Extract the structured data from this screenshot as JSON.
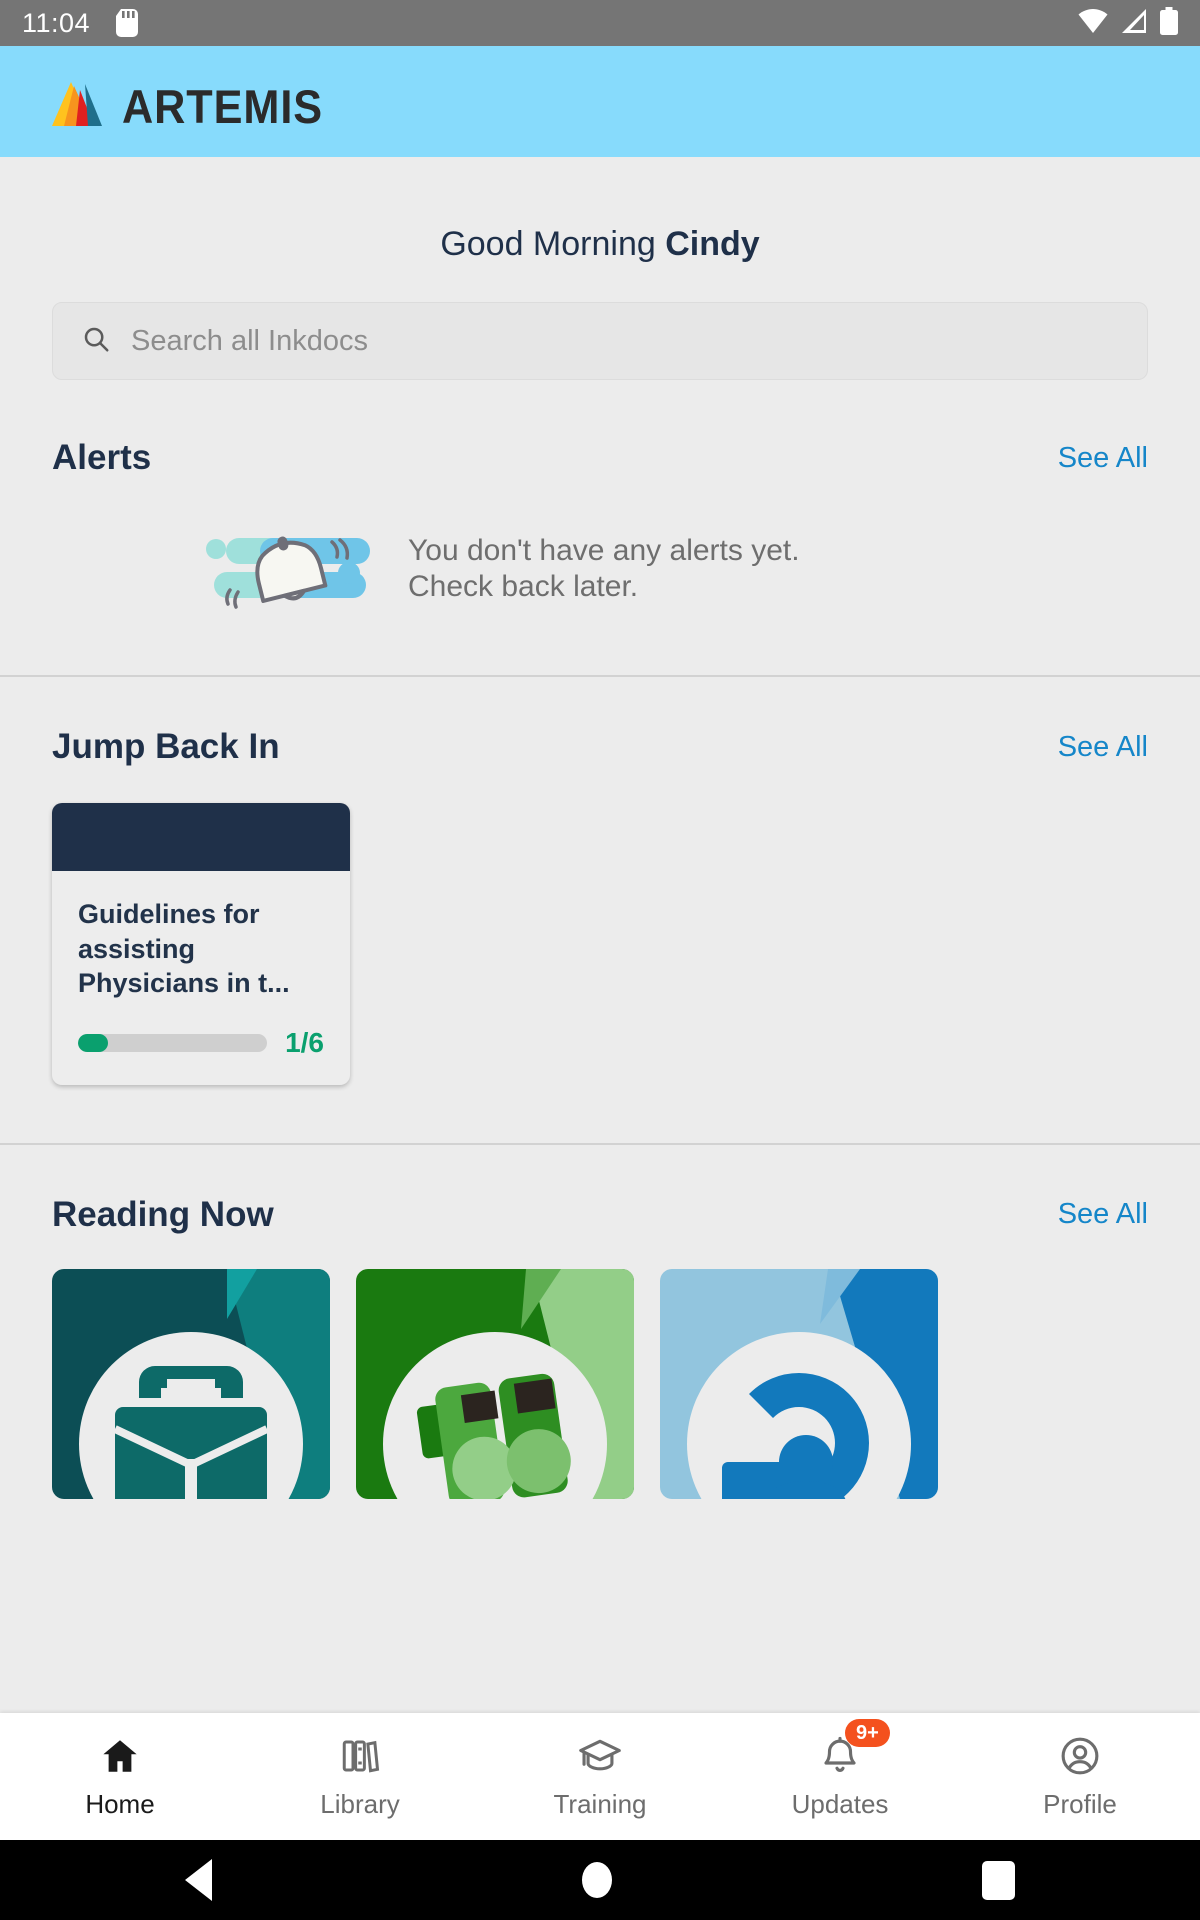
{
  "status_bar": {
    "time": "11:04",
    "sd_card_icon": "sd-card-icon",
    "wifi_icon": "wifi-icon",
    "signal_icon": "cellular-signal-icon",
    "battery_icon": "battery-icon"
  },
  "app_bar": {
    "brand": "ARTEMIS",
    "logo_icon": "artemis-mountain-logo",
    "background": "#87DBFC",
    "logo_colors": [
      "#FFC21E",
      "#F7941E",
      "#E02020",
      "#1F6F8B"
    ]
  },
  "greeting": {
    "prefix": "Good Morning ",
    "name": "Cindy"
  },
  "search": {
    "placeholder": "Search all Inkdocs",
    "value": "",
    "icon": "search-icon"
  },
  "alerts": {
    "title": "Alerts",
    "see_all": "See All",
    "empty_line1": "You don't have any alerts yet.",
    "empty_line2": "Check back later.",
    "illustration": "empty-bell-illustration"
  },
  "jump_back_in": {
    "title": "Jump Back In",
    "see_all": "See All",
    "cards": [
      {
        "title": "Guidelines for assisting Physicians in t...",
        "progress_label": "1/6",
        "progress_current": 1,
        "progress_total": 6,
        "progress_percent": 16,
        "cover_color": "#1F3049",
        "progress_color": "#0AA06E"
      }
    ]
  },
  "reading_now": {
    "title": "Reading Now",
    "see_all": "See All",
    "cards": [
      {
        "icon": "briefcase-icon",
        "bg_dark": "#0C4E55",
        "bg_mid": "#0E7E7E",
        "bg_light": "#12A0A0",
        "circle": "#ECECEC",
        "glyph": "#0D6A68"
      },
      {
        "icon": "binoculars-icon",
        "bg_dark": "#1A7A10",
        "bg_mid": "#5FAE52",
        "bg_light": "#93CE88",
        "circle": "#ECECEC",
        "glyph": "#4CA83E"
      },
      {
        "icon": "broadcast-person-icon",
        "bg_dark": "#92C5DE",
        "bg_mid": "#1279BC",
        "bg_light": "#7FBBDC",
        "circle": "#ECECEC",
        "glyph": "#1279BC"
      }
    ]
  },
  "bottom_nav": {
    "items": [
      {
        "label": "Home",
        "icon": "home-icon",
        "active": true,
        "badge": ""
      },
      {
        "label": "Library",
        "icon": "library-books-icon",
        "active": false,
        "badge": ""
      },
      {
        "label": "Training",
        "icon": "graduation-cap-icon",
        "active": false,
        "badge": ""
      },
      {
        "label": "Updates",
        "icon": "bell-icon",
        "active": false,
        "badge": "9+"
      },
      {
        "label": "Profile",
        "icon": "account-circle-icon",
        "active": false,
        "badge": ""
      }
    ],
    "badge_color": "#F4511E"
  },
  "android_nav": {
    "back": "back-button",
    "home": "home-button",
    "recents": "recents-button"
  }
}
